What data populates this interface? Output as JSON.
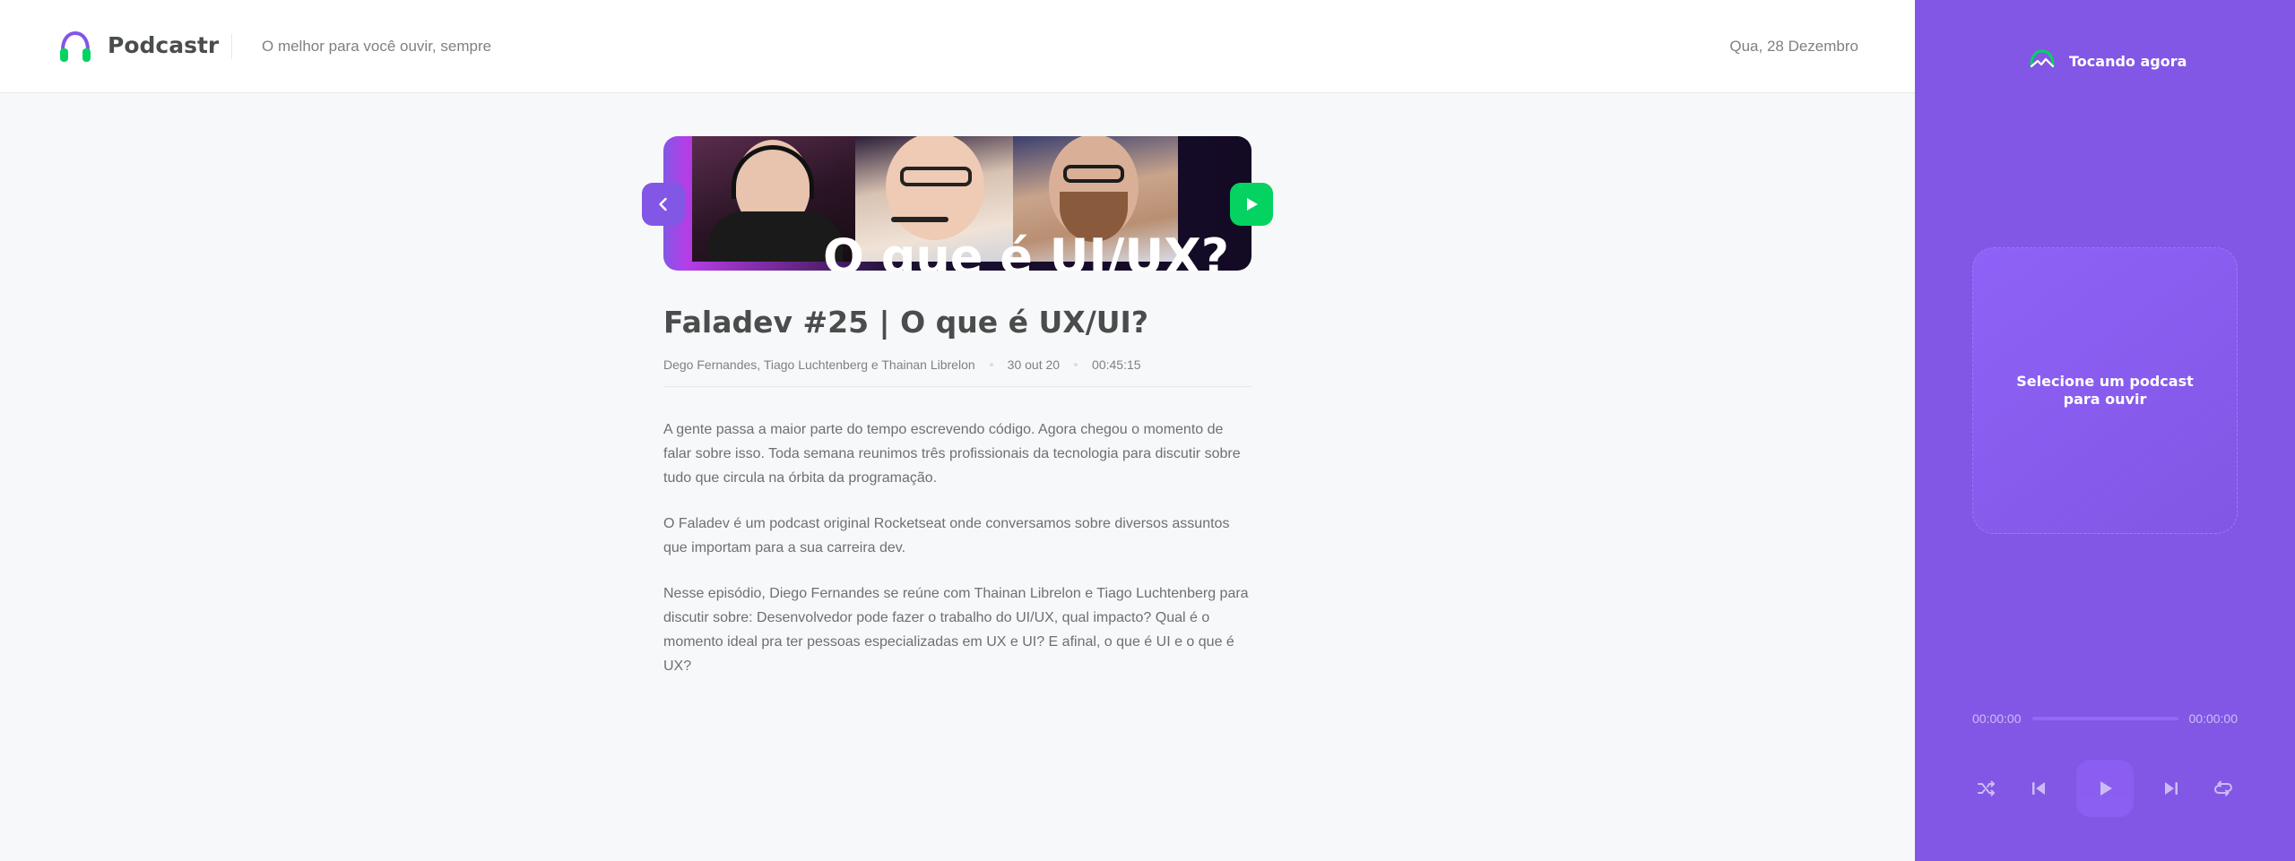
{
  "header": {
    "app_name": "Podcastr",
    "tagline": "O melhor para você ouvir, sempre",
    "date": "Qua, 28 Dezembro",
    "logo_icon": "headphones-icon"
  },
  "episode": {
    "thumbnail_text": "O que é UI/UX?",
    "title": "Faladev #25 | O que é UX/UI?",
    "members": "Dego Fernandes, Tiago Luchtenberg e Thainan Librelon",
    "published_at": "30 out 20",
    "duration": "00:45:15",
    "description": [
      "A gente passa a maior parte do tempo escrevendo código. Agora chegou o momento de falar sobre isso. Toda semana reunimos três profissionais da tecnologia para discutir sobre tudo que circula na órbita da programação.",
      "O Faladev é um podcast original Rocketseat onde conversamos sobre diversos assuntos que importam para a sua carreira dev.",
      "Nesse episódio, Diego Fernandes se reúne com Thainan Librelon e Tiago Luchtenberg para discutir sobre: Desenvolvedor pode fazer o trabalho do UI/UX, qual impacto? Qual é o momento ideal pra ter pessoas especializadas em UX e UI? E afinal, o que é UI e o que é UX?"
    ],
    "back_icon": "chevron-left-icon",
    "play_icon": "play-icon"
  },
  "player": {
    "title": "Tocando agora",
    "empty_message": "Selecione um podcast para ouvir",
    "current_time": "00:00:00",
    "total_time": "00:00:00",
    "progress": 0,
    "controls": [
      "shuffle-icon",
      "previous-icon",
      "play-icon",
      "next-icon",
      "repeat-icon"
    ]
  },
  "colors": {
    "purple": "#8257e5",
    "green": "#04d361",
    "background": "#f7f8fa",
    "text": "#494d4b",
    "muted": "#808080"
  }
}
